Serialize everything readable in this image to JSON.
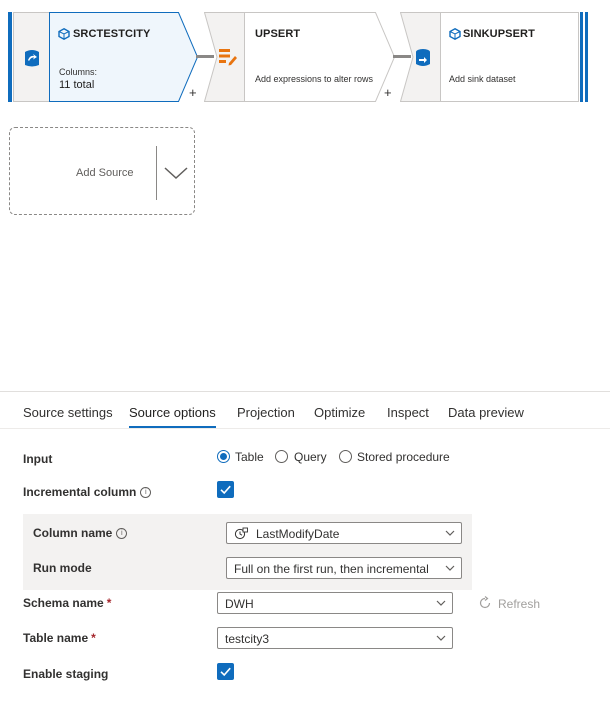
{
  "flow": {
    "source_node": {
      "title": "SRCTESTCITY",
      "columns_label": "Columns:",
      "columns_value": "11 total"
    },
    "upsert_node": {
      "title": "UPSERT",
      "description": "Add expressions to alter rows"
    },
    "sink_node": {
      "title": "SINKUPSERT",
      "description": "Add sink dataset"
    },
    "add_symbol": "+",
    "add_source_label": "Add Source"
  },
  "tabs": [
    {
      "label": "Source settings"
    },
    {
      "label": "Source options"
    },
    {
      "label": "Projection"
    },
    {
      "label": "Optimize"
    },
    {
      "label": "Inspect"
    },
    {
      "label": "Data preview"
    }
  ],
  "active_tab": "Source options",
  "form": {
    "input": {
      "label": "Input",
      "options": [
        "Table",
        "Query",
        "Stored procedure"
      ],
      "selected": "Table"
    },
    "incremental_column": {
      "label": "Incremental column",
      "checked": true
    },
    "column_name": {
      "label": "Column name",
      "value": "LastModifyDate"
    },
    "run_mode": {
      "label": "Run mode",
      "value": "Full on the first run, then incremental"
    },
    "schema_name": {
      "label": "Schema name",
      "required_marker": "*",
      "value": "DWH",
      "refresh_label": "Refresh"
    },
    "table_name": {
      "label": "Table name",
      "required_marker": "*",
      "value": "testcity3"
    },
    "enable_staging": {
      "label": "Enable staging",
      "checked": true
    }
  },
  "colors": {
    "accent": "#0f6cbd",
    "transform_orange": "#e8740f",
    "required": "#a4262c"
  }
}
